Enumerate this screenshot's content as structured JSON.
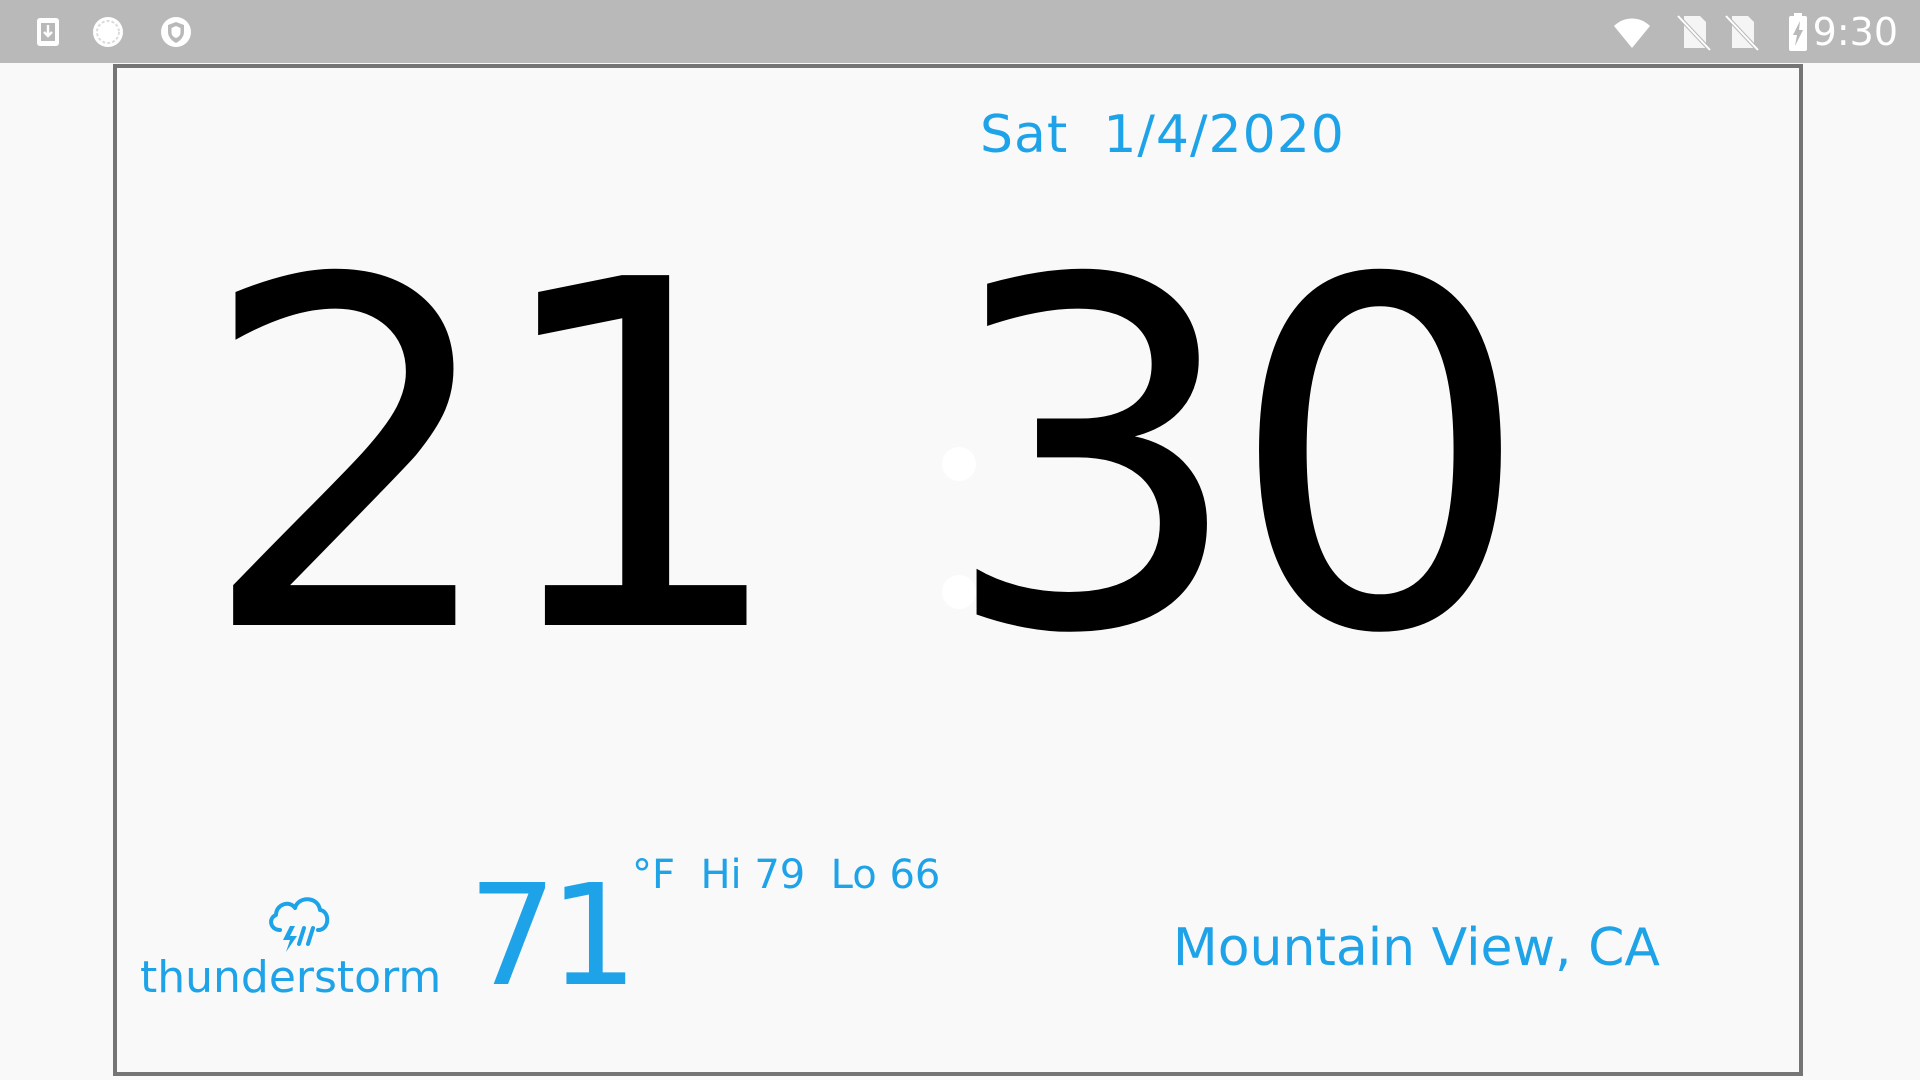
{
  "status_bar": {
    "time": "9:30",
    "left_icons": [
      "download-notification-icon",
      "loading-spinner-icon",
      "vpn-shield-icon"
    ],
    "right_icons": [
      "wifi-icon",
      "no-sim-icon",
      "no-sim-2-icon",
      "battery-charging-icon"
    ]
  },
  "clock": {
    "date": "Sat  1/4/2020",
    "hours": "21",
    "minutes": "30"
  },
  "weather": {
    "icon": "thunderstorm-icon",
    "condition": "thunderstorm",
    "temperature": "71",
    "unit_hi_lo": "°F  Hi 79  Lo 66",
    "location": "Mountain View, CA"
  },
  "colors": {
    "accent": "#1ea3e8",
    "status_bar": "#b9b9b9",
    "background": "#f9f9f9",
    "frame": "#757575",
    "digits": "#000000"
  }
}
